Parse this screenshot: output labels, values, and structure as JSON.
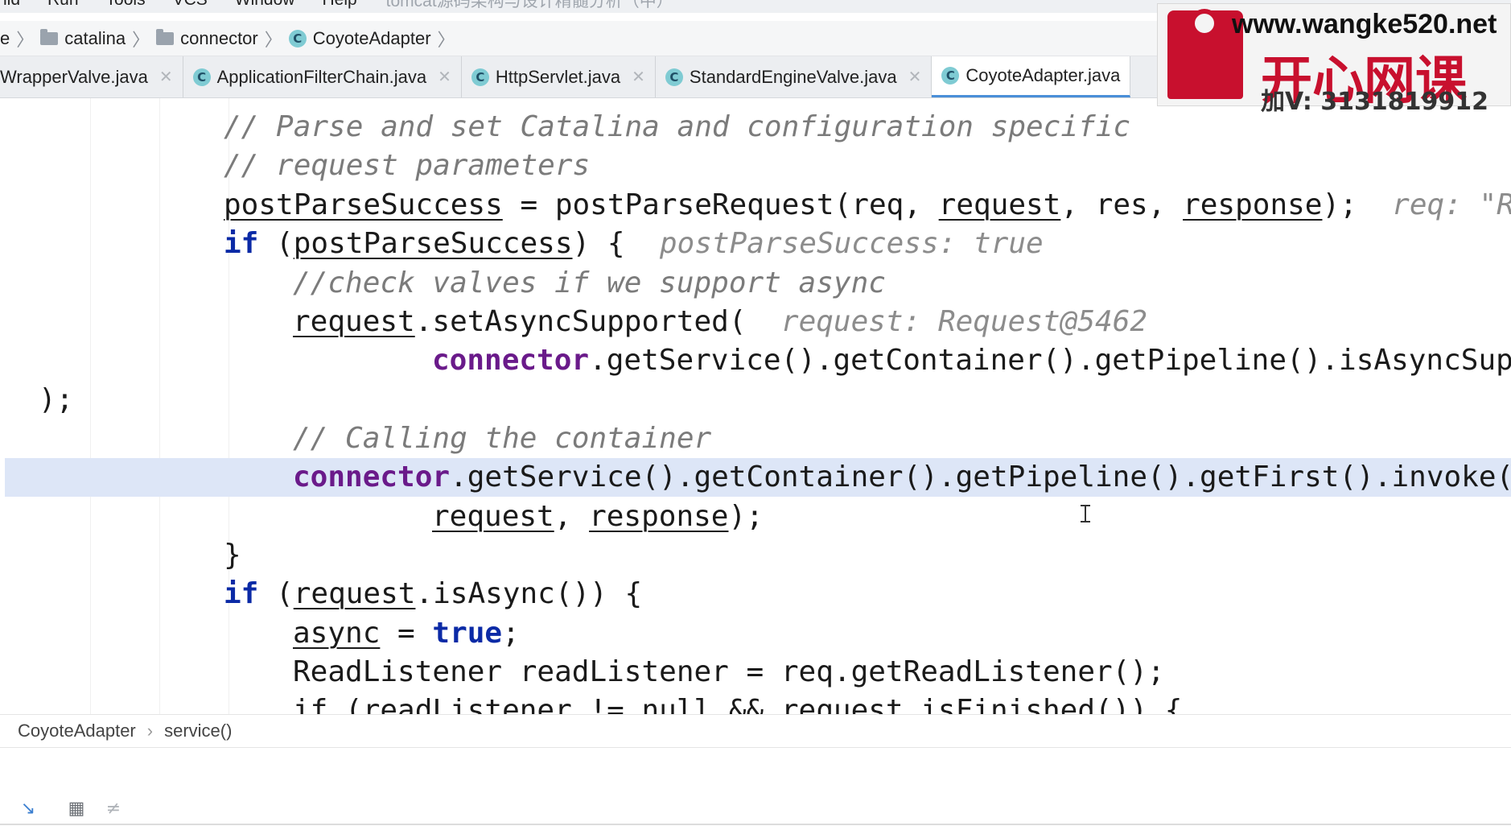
{
  "menu": {
    "items": [
      "ild",
      "Run",
      "Tools",
      "VCS",
      "Window",
      "Help"
    ],
    "video_title": "tomcat源码架构与设计精髓分析（中）"
  },
  "navbar": {
    "partial": "e",
    "crumbs": [
      "catalina",
      "connector",
      "CoyoteAdapter"
    ]
  },
  "tabs": [
    {
      "label": "WrapperValve.java"
    },
    {
      "label": "ApplicationFilterChain.java"
    },
    {
      "label": "HttpServlet.java"
    },
    {
      "label": "StandardEngineValve.java"
    },
    {
      "label": "CoyoteAdapter.java"
    }
  ],
  "code": {
    "line1": "// Parse and set Catalina and configuration specific",
    "line2": "// request parameters",
    "line3_var": "postParseSuccess",
    "line3_call": "postParseRequest",
    "line3_hint": "req: \"R",
    "line4_var": "postParseSuccess",
    "line4_hint": "postParseSuccess: true",
    "line5": "//check valves if we support async",
    "line6_obj": "request",
    "line6_call": ".setAsyncSupported(",
    "line6_hint": "request: Request@5462",
    "line7_field": "connector",
    "line7_call": ".getService().getContainer().getPipeline().isAsyncSupp",
    "line8": ");",
    "line9": "// Calling the container",
    "line10_field": "connector",
    "line10_call": ".getService().getContainer().getPipeline().getFirst().invoke(",
    "line11_a": "request",
    "line11_b": "response",
    "line12": "}",
    "line13_obj": "request",
    "line13_call": ".isAsync()) {",
    "line14_var": "async",
    "line15": "ReadListener readListener = req.getReadListener();",
    "line16": "if (readListener != null && request.isFinished()) {"
  },
  "watermark": {
    "url": "www.wangke520.net",
    "brand": "开心网课",
    "contact": "加V: 3131819912"
  },
  "structure": {
    "class_name": "CoyoteAdapter",
    "method": "service()"
  }
}
